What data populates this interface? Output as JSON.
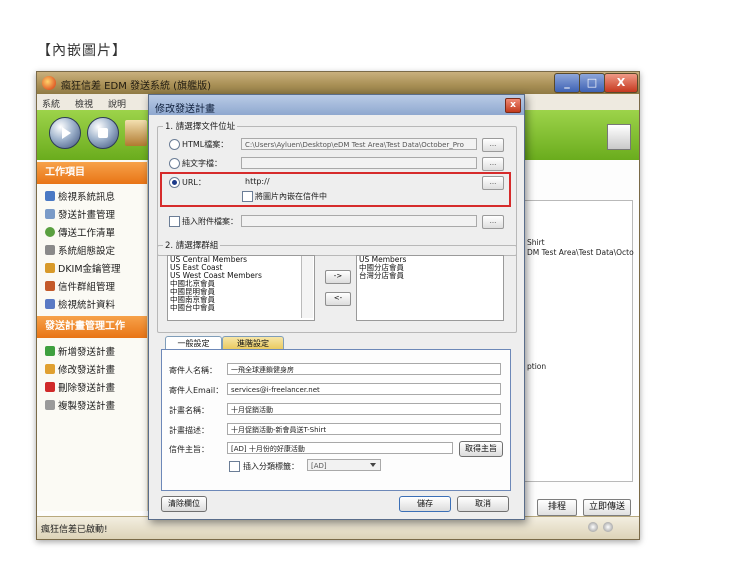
{
  "caption": "【內嵌圖片】",
  "app": {
    "title": "瘋狂信差 EDM 發送系統 (旗艦版)",
    "menu": [
      "系統",
      "檢視",
      "說明"
    ],
    "sidebar": {
      "section1_title": "工作項目",
      "section1_items": [
        "檢視系統訊息",
        "發送計畫管理",
        "傳送工作清單",
        "系統組態設定",
        "DKIM金鑰管理",
        "信件群組管理",
        "檢視統計資料"
      ],
      "section2_title": "發送計畫管理工作",
      "section2_items": [
        "新增發送計畫",
        "修改發送計畫",
        "刪除發送計畫",
        "複製發送計畫"
      ]
    },
    "content_lines": [
      "Shirt",
      "DM Test Area\\Test Data\\Octo",
      "ption"
    ],
    "buttons": {
      "schedule": "排程",
      "send_now": "立即傳送"
    },
    "status": "瘋狂信差已啟動!"
  },
  "dialog": {
    "title": "修改發送計畫",
    "section1": {
      "legend": "1. 請選擇文件位址",
      "html_label": "HTML檔案：",
      "html_value": "C:\\Users\\Ayluen\\Desktop\\eDM Test Area\\Test Data\\October_Pro",
      "text_label": "純文字檔：",
      "url_label": "URL：",
      "url_value": "http://",
      "embed_images_label": "將圖片內嵌在信件中",
      "attach_label": "插入附件檔案：",
      "browse": "..."
    },
    "section2": {
      "legend": "2. 請選擇群組",
      "available_groups": [
        "US Central Members",
        "US East Coast",
        "US West Coast Members",
        "中國北京會員",
        "中國昆明會員",
        "中國南京會員",
        "中國台中會員"
      ],
      "selected_groups": [
        "US Members",
        "中國分店會員",
        "台灣分店會員"
      ],
      "add_arrow": "->",
      "remove_arrow": "<-"
    },
    "tabs": [
      "一般設定",
      "進階設定"
    ],
    "general": {
      "sender_name_label": "寄件人名稱：",
      "sender_name_value": "一飛全球連鎖健身房",
      "sender_email_label": "寄件人Email：",
      "sender_email_value": "services@i-freelancer.net",
      "plan_name_label": "計畫名稱：",
      "plan_name_value": "十月促銷活動",
      "plan_desc_label": "計畫描述：",
      "plan_desc_value": "十月促銷活動-新會員送T-Shirt",
      "subject_label": "信件主旨：",
      "subject_value": "[AD] 十月份的好康活動",
      "get_subject_button": "取得主旨",
      "insert_tag_label": "插入分類標籤：",
      "tag_value": "[AD]"
    },
    "buttons": {
      "clear": "清除欄位",
      "save": "儲存",
      "cancel": "取消"
    }
  },
  "colors": {
    "highlight_border": "#d62b2b",
    "sidebar_header": "#e87415",
    "toolbar_green": "#6aac1d"
  }
}
